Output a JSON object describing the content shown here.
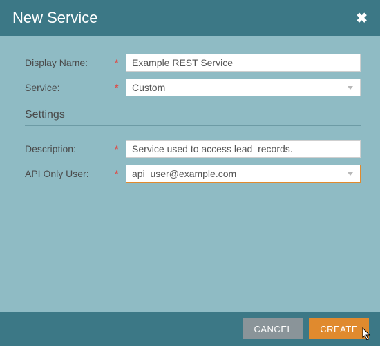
{
  "title": "New Service",
  "labels": {
    "display_name": "Display Name:",
    "service": "Service:",
    "description": "Description:",
    "api_user": "API Only User:"
  },
  "section_title": "Settings",
  "fields": {
    "display_name": "Example REST Service",
    "service": "Custom",
    "description": "Service used to access lead  records.",
    "api_user": "api_user@example.com"
  },
  "buttons": {
    "cancel": "CANCEL",
    "create": "CREATE"
  },
  "required_marker": "*"
}
